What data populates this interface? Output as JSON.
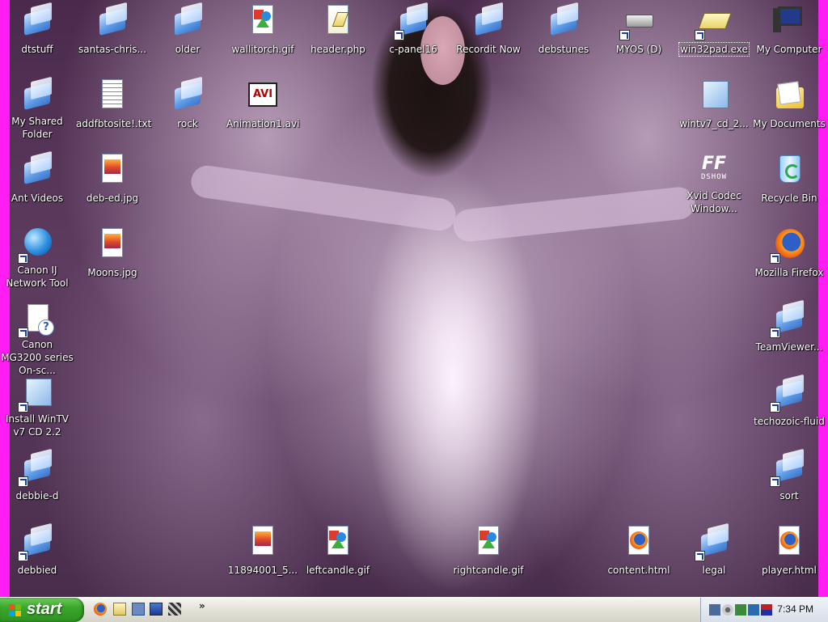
{
  "desktop": {
    "icons": [
      {
        "label": "dtstuff",
        "icon": "folder-icon",
        "shortcut": false
      },
      {
        "label": "santas-chris...",
        "icon": "folder-icon",
        "shortcut": false
      },
      {
        "label": "older",
        "icon": "folder-icon",
        "shortcut": false
      },
      {
        "label": "wallitorch.gif",
        "icon": "gif-image-icon",
        "shortcut": false
      },
      {
        "label": "header.php",
        "icon": "php-file-icon",
        "shortcut": false
      },
      {
        "label": "c-panel16",
        "icon": "folder-icon",
        "shortcut": true
      },
      {
        "label": "Recordit Now",
        "icon": "folder-icon",
        "shortcut": false
      },
      {
        "label": "debstunes",
        "icon": "folder-icon",
        "shortcut": false
      },
      {
        "label": "MYOS (D)",
        "icon": "drive-icon",
        "shortcut": true
      },
      {
        "label": "win32pad.exe",
        "icon": "notepad-app-icon",
        "shortcut": true
      },
      {
        "label": "My Computer",
        "icon": "computer-icon",
        "shortcut": false
      },
      {
        "label": "My Shared Folder",
        "icon": "folder-icon",
        "shortcut": false
      },
      {
        "label": "addfbtosite!.txt",
        "icon": "text-file-icon",
        "shortcut": false
      },
      {
        "label": "rock",
        "icon": "folder-icon",
        "shortcut": false
      },
      {
        "label": "Animation1.avi",
        "icon": "avi-video-icon",
        "shortcut": false
      },
      {
        "label": "wintv7_cd_2...",
        "icon": "installer-icon",
        "shortcut": false
      },
      {
        "label": "My Documents",
        "icon": "documents-folder-icon",
        "shortcut": false
      },
      {
        "label": "Ant Videos",
        "icon": "folder-icon",
        "shortcut": false
      },
      {
        "label": "deb-ed.jpg",
        "icon": "jpg-image-icon",
        "shortcut": false
      },
      {
        "label": "Xvid Codec Window...",
        "icon": "ffdshow-icon",
        "shortcut": false
      },
      {
        "label": "Recycle Bin",
        "icon": "recycle-bin-icon",
        "shortcut": false
      },
      {
        "label": "Canon IJ Network Tool",
        "icon": "network-globe-icon",
        "shortcut": true
      },
      {
        "label": "Moons.jpg",
        "icon": "jpg-image-icon",
        "shortcut": false
      },
      {
        "label": "Mozilla Firefox",
        "icon": "firefox-icon",
        "shortcut": true
      },
      {
        "label": "Canon MG3200 series On-sc...",
        "icon": "help-document-icon",
        "shortcut": true
      },
      {
        "label": "TeamViewer...",
        "icon": "folder-icon",
        "shortcut": true
      },
      {
        "label": "Install WinTV v7 CD 2.2",
        "icon": "installer-icon",
        "shortcut": true
      },
      {
        "label": "techozoic-fluid",
        "icon": "folder-icon",
        "shortcut": true
      },
      {
        "label": "debbie-d",
        "icon": "folder-icon",
        "shortcut": true
      },
      {
        "label": "sort",
        "icon": "folder-icon",
        "shortcut": true
      },
      {
        "label": "debbied",
        "icon": "folder-icon",
        "shortcut": true
      },
      {
        "label": "11894001_5...",
        "icon": "jpg-image-icon",
        "shortcut": false
      },
      {
        "label": "leftcandle.gif",
        "icon": "gif-image-icon",
        "shortcut": false
      },
      {
        "label": "rightcandle.gif",
        "icon": "gif-image-icon",
        "shortcut": false
      },
      {
        "label": "content.html",
        "icon": "firefox-html-icon",
        "shortcut": false
      },
      {
        "label": "legal",
        "icon": "folder-icon",
        "shortcut": true
      },
      {
        "label": "player.html",
        "icon": "firefox-html-icon",
        "shortcut": false
      }
    ]
  },
  "taskbar": {
    "start_label": "start",
    "quick_launch": [
      "firefox-icon",
      "notepad-icon",
      "show-desktop-icon",
      "screen-icon",
      "task-icon"
    ],
    "overflow_label": "»",
    "tray_icons": [
      "network-icon",
      "volume-icon",
      "security-icon",
      "update-icon",
      "flag-icon"
    ],
    "clock": "7:34 PM"
  },
  "colors": {
    "screen_edge": "#ff1df3",
    "start_button": "#3aa72b",
    "taskbar": "#e6e5dd"
  }
}
